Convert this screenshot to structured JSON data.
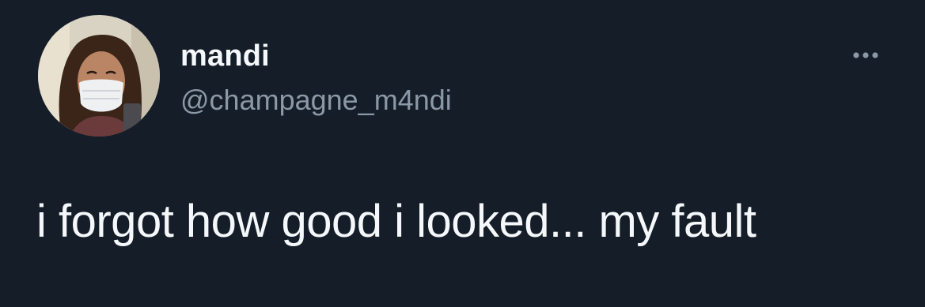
{
  "user": {
    "display_name": "mandi",
    "handle": "@champagne_m4ndi",
    "avatar_icon": "profile-photo"
  },
  "tweet": {
    "text": "i forgot how good i looked... my fault"
  },
  "actions": {
    "more_icon": "ellipsis-icon"
  },
  "colors": {
    "background": "#151d29",
    "primary_text": "#f5f8fa",
    "secondary_text": "#8b98a5"
  }
}
